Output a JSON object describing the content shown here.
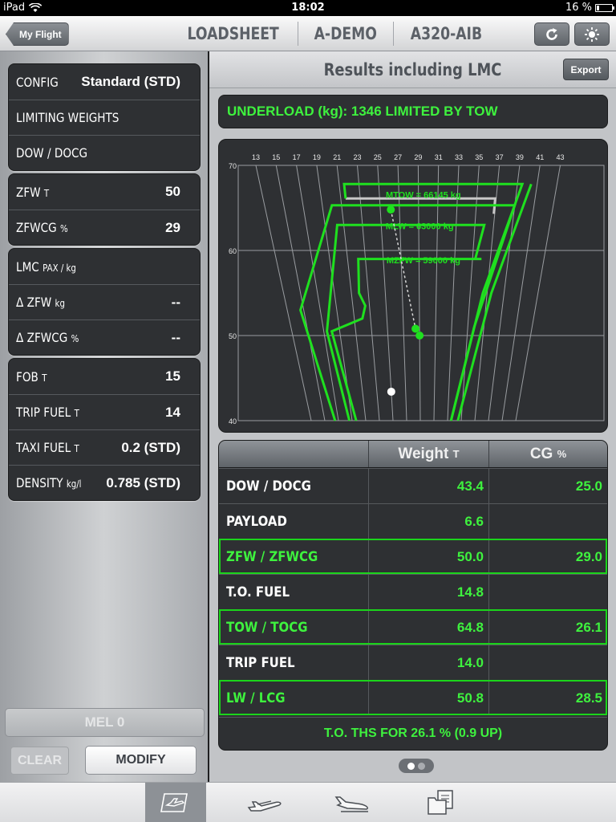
{
  "status_bar": {
    "carrier": "iPad",
    "time": "18:02",
    "battery_text": "16 %",
    "battery_level": 0.16
  },
  "nav": {
    "back_label": "My Flight",
    "titles": [
      "LOADSHEET",
      "A-DEMO",
      "A320-AIB"
    ],
    "refresh_icon": "refresh-icon",
    "brightness_icon": "brightness-icon"
  },
  "left": {
    "group1": [
      {
        "label": "CONFIG",
        "unit": "",
        "value": "Standard (STD)"
      },
      {
        "label": "LIMITING WEIGHTS",
        "unit": "",
        "value": ""
      },
      {
        "label": "DOW / DOCG",
        "unit": "",
        "value": ""
      }
    ],
    "group2": [
      {
        "label": "ZFW",
        "unit": "T",
        "value": "50"
      },
      {
        "label": "ZFWCG",
        "unit": "%",
        "value": "29"
      }
    ],
    "group3": [
      {
        "label": "LMC",
        "unit": "PAX / kg",
        "value": ""
      },
      {
        "label": "Δ ZFW",
        "unit": "kg",
        "value": "--"
      },
      {
        "label": "Δ ZFWCG",
        "unit": "%",
        "value": "--"
      }
    ],
    "group4": [
      {
        "label": "FOB",
        "unit": "T",
        "value": "15"
      },
      {
        "label": "TRIP FUEL",
        "unit": "T",
        "value": "14"
      },
      {
        "label": "TAXI FUEL",
        "unit": "T",
        "value": "0.2 (STD)"
      },
      {
        "label": "DENSITY",
        "unit": "kg/l",
        "value": "0.785 (STD)"
      }
    ],
    "mel_label": "MEL 0",
    "clear_label": "CLEAR",
    "modify_label": "MODIFY"
  },
  "right": {
    "header_title": "Results including LMC",
    "export_label": "Export",
    "underload_text": "UNDERLOAD (kg): 1346 LIMITED BY TOW",
    "table": {
      "headers": {
        "weight": "Weight",
        "weight_unit": "T",
        "cg": "CG",
        "cg_unit": "%"
      },
      "rows": [
        {
          "label": "DOW / DOCG",
          "weight": "43.4",
          "cg": "25.0",
          "highlight": false
        },
        {
          "label": "PAYLOAD",
          "weight": "6.6",
          "cg": "",
          "highlight": false
        },
        {
          "label": "ZFW / ZFWCG",
          "weight": "50.0",
          "cg": "29.0",
          "highlight": true
        },
        {
          "label": "T.O. FUEL",
          "weight": "14.8",
          "cg": "",
          "highlight": false
        },
        {
          "label": "TOW / TOCG",
          "weight": "64.8",
          "cg": "26.1",
          "highlight": true
        },
        {
          "label": "TRIP FUEL",
          "weight": "14.0",
          "cg": "",
          "highlight": false
        },
        {
          "label": "LW / LCG",
          "weight": "50.8",
          "cg": "28.5",
          "highlight": true
        }
      ],
      "footer": "T.O. THS FOR 26.1 % (0.9 UP)"
    }
  },
  "chart_data": {
    "type": "scatter",
    "title": "",
    "x_ticks": [
      "13",
      "15",
      "17",
      "19",
      "21",
      "23",
      "25",
      "27",
      "29",
      "31",
      "33",
      "35",
      "37",
      "39",
      "41",
      "43"
    ],
    "y_ticks": [
      "70",
      "60",
      "50",
      "40"
    ],
    "ylim": [
      40,
      70
    ],
    "limit_labels": [
      "MTOW = 66145 kg",
      "MLW = 63000 kg",
      "MZFW = 59000 kg"
    ],
    "points": [
      {
        "name": "TOW",
        "cg": 26.1,
        "weight": 64.8
      },
      {
        "name": "ZFW",
        "cg": 29.0,
        "weight": 50.0
      },
      {
        "name": "LW",
        "cg": 28.5,
        "weight": 50.8
      },
      {
        "name": "DOW",
        "cg": 25.0,
        "weight": 43.4
      }
    ],
    "colors": {
      "envelope": "#1fe01f",
      "grid": "#9a9da1",
      "limit_box": "#c8c8c8",
      "dow_point": "#ffffff"
    }
  },
  "pager": {
    "pages": 2,
    "current": 1
  },
  "tabbar": {
    "icons": [
      "loadsheet-tab-icon",
      "takeoff-tab-icon",
      "landing-tab-icon",
      "documents-tab-icon"
    ],
    "active": 0
  }
}
